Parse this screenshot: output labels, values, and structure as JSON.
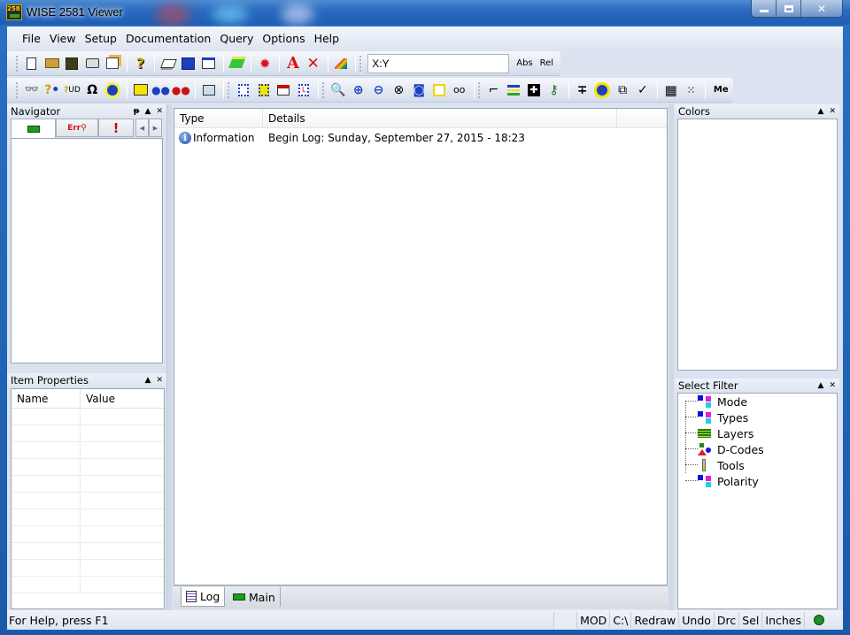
{
  "window": {
    "title": "WISE 2581 Viewer",
    "app_icon_text": "2581",
    "minimize_label": "–",
    "maximize_label": "□",
    "close_label": "✕"
  },
  "menu": {
    "items": [
      {
        "label": "File",
        "mnemonic": "F"
      },
      {
        "label": "View",
        "mnemonic": "V"
      },
      {
        "label": "Setup",
        "mnemonic": "S"
      },
      {
        "label": "Documentation",
        "mnemonic": "c"
      },
      {
        "label": "Query",
        "mnemonic": "Q"
      },
      {
        "label": "Options",
        "mnemonic": "O"
      },
      {
        "label": "Help",
        "mnemonic": "H"
      }
    ]
  },
  "toolbar1": {
    "buttons": [
      "new-file-icon",
      "open-folder-icon",
      "save-icon",
      "print-icon",
      "properties-icon",
      "help-icon",
      "layers-stack-icon",
      "display-icon",
      "preview-icon",
      "highlight-layers-icon",
      "bulb-icon",
      "text-icon",
      "delete-icon",
      "color-brush-icon"
    ],
    "coordinate_value": "X:Y",
    "abs_label": "Abs",
    "rel_label": "Rel"
  },
  "toolbar2": {
    "buttons": [
      "find-binoculars-icon",
      "query-net-icon",
      "query-ud-icon",
      "query-ohm-icon",
      "highlight-icon",
      "measure-ruler-icon",
      "distance-icon",
      "clearance-icon",
      "dimension-icon",
      "component-query-icon",
      "component-help-icon",
      "sofi-icon",
      "component-l-icon",
      "zoom-window-icon",
      "zoom-in-icon",
      "zoom-out-icon",
      "zoom-previous-icon",
      "zoom-fit-icon",
      "zoom-select-icon",
      "glasses-icon",
      "snap-icon",
      "align-icon",
      "center-icon",
      "key-icon",
      "cross-section-icon",
      "flash-icon",
      "select-region-icon",
      "check-icon",
      "grid-icon",
      "origin-icon"
    ],
    "me_label": "Me"
  },
  "navigator": {
    "title": "Navigator",
    "pin_label": "ᵽ",
    "tabs": [
      "board-icon",
      "error-search-icon",
      "warning-icon"
    ]
  },
  "item_properties": {
    "title": "Item Properties",
    "columns": [
      "Name",
      "Value"
    ],
    "rows": 11
  },
  "log": {
    "columns": [
      "Type",
      "Details"
    ],
    "rows": [
      {
        "type": "Information",
        "details": "Begin Log: Sunday, September 27, 2015 - 18:23"
      }
    ],
    "tabs": [
      {
        "label": "Log",
        "active": true
      },
      {
        "label": "Main",
        "active": false
      }
    ]
  },
  "colors_panel": {
    "title": "Colors"
  },
  "select_filter": {
    "title": "Select Filter",
    "items": [
      "Mode",
      "Types",
      "Layers",
      "D-Codes",
      "Tools",
      "Polarity"
    ]
  },
  "status": {
    "help_text": "For Help, press F1",
    "cells": [
      "MOD",
      "C:\\",
      "Redraw",
      "Undo",
      "Drc",
      "Sel",
      "Inches"
    ],
    "indicator_color": "#1e8f2a"
  }
}
